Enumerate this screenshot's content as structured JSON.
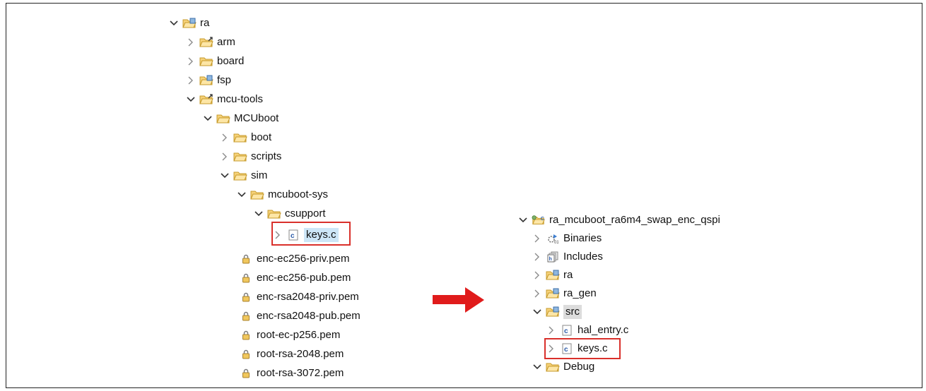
{
  "left_tree": {
    "root": "ra",
    "arm": "arm",
    "board": "board",
    "fsp": "fsp",
    "mcu_tools": "mcu-tools",
    "mcuboot": "MCUboot",
    "boot": "boot",
    "scripts": "scripts",
    "sim": "sim",
    "mcuboot_sys": "mcuboot-sys",
    "csupport": "csupport",
    "keys_c": "keys.c",
    "pem_files": [
      "enc-ec256-priv.pem",
      "enc-ec256-pub.pem",
      "enc-rsa2048-priv.pem",
      "enc-rsa2048-pub.pem",
      "root-ec-p256.pem",
      "root-rsa-2048.pem",
      "root-rsa-3072.pem"
    ]
  },
  "right_tree": {
    "project": "ra_mcuboot_ra6m4_swap_enc_qspi",
    "binaries": "Binaries",
    "includes": "Includes",
    "ra": "ra",
    "ra_gen": "ra_gen",
    "src": "src",
    "hal_entry": "hal_entry.c",
    "keys_c": "keys.c",
    "debug": "Debug"
  },
  "colors": {
    "highlight_border": "#d9302b",
    "arrow": "#e01b1b",
    "folder": "#f0c75e"
  }
}
